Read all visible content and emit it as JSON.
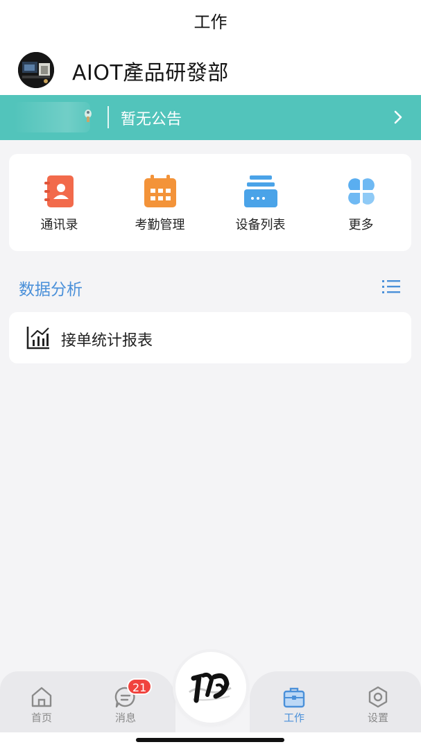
{
  "header": {
    "title": "工作"
  },
  "org": {
    "name": "AIOT產品研發部"
  },
  "notice": {
    "text": "暂无公告"
  },
  "quick_actions": [
    {
      "label": "通讯录",
      "icon": "contacts-book-icon",
      "color": "#f26a4b"
    },
    {
      "label": "考勤管理",
      "icon": "calendar-icon",
      "color": "#f39339"
    },
    {
      "label": "设备列表",
      "icon": "device-list-icon",
      "color": "#4aa3e8"
    },
    {
      "label": "更多",
      "icon": "more-grid-icon",
      "color": "#5aaef0"
    }
  ],
  "analysis": {
    "title": "数据分析",
    "items": [
      {
        "label": "接单统计报表",
        "icon": "bar-chart-icon"
      }
    ]
  },
  "tabbar": {
    "tabs": [
      {
        "label": "首页",
        "icon": "home-icon"
      },
      {
        "label": "消息",
        "icon": "message-icon",
        "badge": "21"
      },
      {
        "label": "工作",
        "icon": "briefcase-icon",
        "active": true
      },
      {
        "label": "设置",
        "icon": "hexagon-settings-icon"
      }
    ]
  },
  "colors": {
    "accent": "#4a90d9",
    "notice_bg": "#52c4bb",
    "badge": "#f0433e"
  }
}
